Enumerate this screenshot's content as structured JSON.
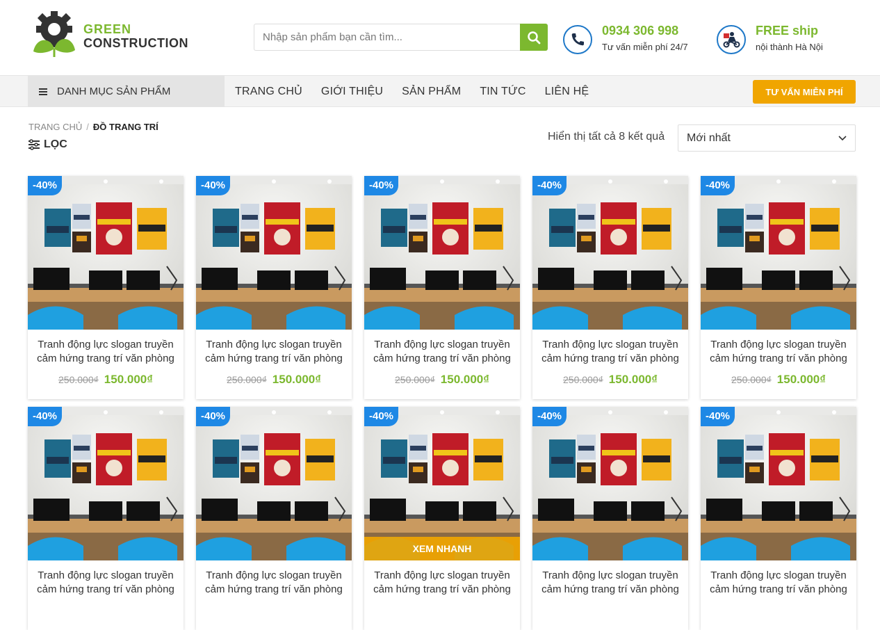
{
  "brand": {
    "line1": "GREEN",
    "line2": "CONSTRUCTION",
    "colors": {
      "green": "#7cb82f",
      "orange": "#f0a500",
      "blue": "#1e88e5"
    }
  },
  "search": {
    "placeholder": "Nhập sản phẩm bạn cần tìm..."
  },
  "contacts": [
    {
      "icon": "phone-icon",
      "title": "0934 306 998",
      "subtitle": "Tư vấn miễn phí 24/7"
    },
    {
      "icon": "delivery-icon",
      "title": "FREE ship",
      "subtitle": "nội thành Hà Nội"
    }
  ],
  "nav": {
    "category_label": "DANH MỤC SẢN PHẨM",
    "menu": [
      "TRANG CHỦ",
      "GIỚI THIỆU",
      "SẢN PHẨM",
      "TIN TỨC",
      "LIÊN HỆ"
    ],
    "cta_label": "TƯ VẤN MIỄN PHÍ"
  },
  "breadcrumb": {
    "home": "TRANG CHỦ",
    "separator": "/",
    "current": "ĐỒ TRANG TRÍ"
  },
  "filter_label": "LỌC",
  "results_text": "Hiển thị tất cả 8 kết quả",
  "sort": {
    "selected": "Mới nhất"
  },
  "quick_view_label": "XEM NHANH",
  "products": [
    {
      "badge": "-40%",
      "name": "Tranh động lực slogan truyền cảm hứng trang trí văn phòng",
      "old_price": "250.000₫",
      "price": "150.000₫"
    },
    {
      "badge": "-40%",
      "name": "Tranh động lực slogan truyền cảm hứng trang trí văn phòng",
      "old_price": "250.000₫",
      "price": "150.000₫"
    },
    {
      "badge": "-40%",
      "name": "Tranh động lực slogan truyền cảm hứng trang trí văn phòng",
      "old_price": "250.000₫",
      "price": "150.000₫"
    },
    {
      "badge": "-40%",
      "name": "Tranh động lực slogan truyền cảm hứng trang trí văn phòng",
      "old_price": "250.000₫",
      "price": "150.000₫"
    },
    {
      "badge": "-40%",
      "name": "Tranh động lực slogan truyền cảm hứng trang trí văn phòng",
      "old_price": "250.000₫",
      "price": "150.000₫"
    },
    {
      "badge": "-40%",
      "name": "Tranh động lực slogan truyền cảm hứng trang trí văn phòng"
    },
    {
      "badge": "-40%",
      "name": "Tranh động lực slogan truyền cảm hứng trang trí văn phòng"
    },
    {
      "badge": "-40%",
      "name": "Tranh động lực slogan truyền cảm hứng trang trí văn phòng",
      "quick_view": true
    },
    {
      "badge": "-40%",
      "name": "Tranh động lực slogan truyền cảm hứng trang trí văn phòng"
    },
    {
      "badge": "-40%",
      "name": "Tranh động lực slogan truyền cảm hứng trang trí văn phòng"
    }
  ]
}
